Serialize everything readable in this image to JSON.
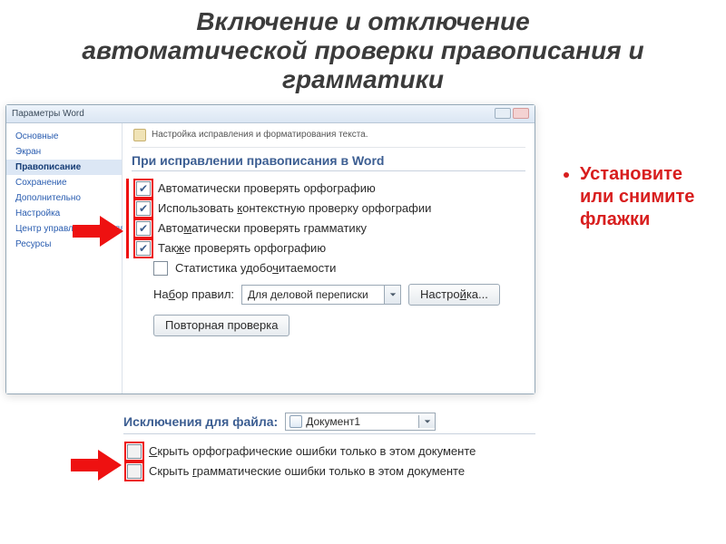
{
  "slide": {
    "title_bold": "Включение и отключение",
    "title_rest": "автоматической проверки правописания и грамматики"
  },
  "dialog": {
    "title": "Параметры Word",
    "pane_caption": "Настройка исправления и форматирования текста.",
    "sidebar": [
      "Основные",
      "Экран",
      "Правописание",
      "Сохранение",
      "Дополнительно",
      "Настройка",
      "Центр управления безопасностью",
      "Ресурсы"
    ],
    "section1_title": "При исправлении правописания в Word",
    "rows": {
      "r0": "Автоматически проверять орфографию",
      "r1_pre": "Использовать ",
      "r1_u": "к",
      "r1_post": "онтекстную проверку орфографии",
      "r2_pre": "Авто",
      "r2_u": "м",
      "r2_post": "атически проверять грамматику",
      "r3_pre": "Так",
      "r3_u": "ж",
      "r3_post": "е проверять орфографию",
      "r4_pre": "Статистика удобо",
      "r4_u": "ч",
      "r4_post": "итаемости"
    },
    "rules_label_pre": "На",
    "rules_label_u": "б",
    "rules_label_post": "ор правил:",
    "rules_value": "Для деловой переписки",
    "settings_btn_pre": "Настро",
    "settings_btn_u": "й",
    "settings_btn_post": "ка...",
    "recheck_btn": "Повторная проверка"
  },
  "exclusions": {
    "title": "Исключения для файла:",
    "doc_name": "Документ1",
    "row0_pre": "",
    "row0_u": "С",
    "row0_post": "крыть орфографические ошибки только в этом документе",
    "row1_pre": "Скрыть ",
    "row1_u": "г",
    "row1_post": "рамматические ошибки только в этом документе"
  },
  "callout": "Установите или снимите флажки"
}
